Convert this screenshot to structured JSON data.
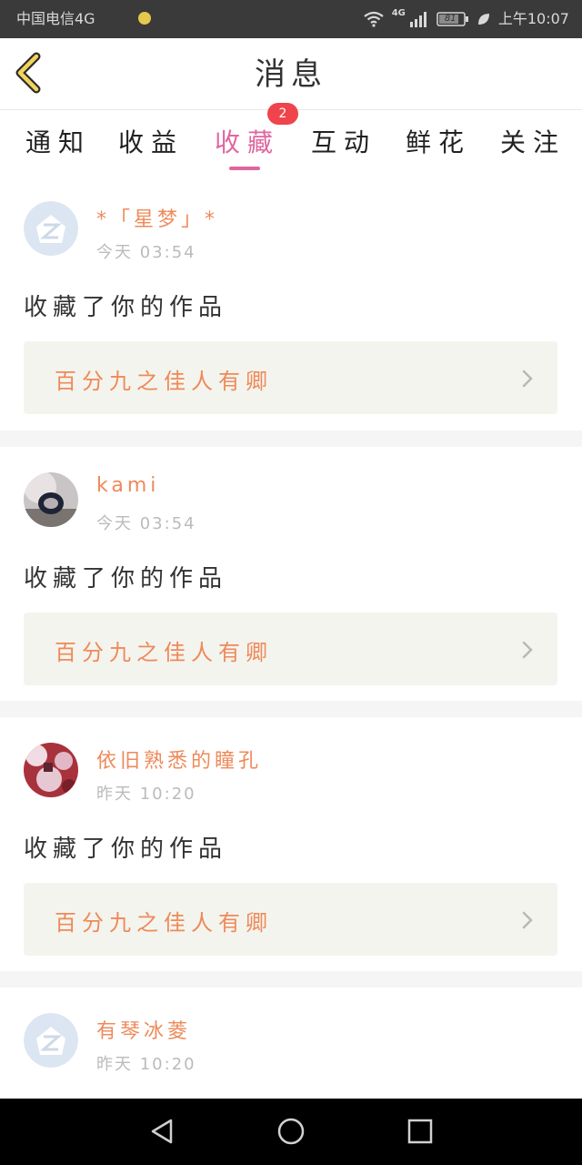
{
  "status_bar": {
    "carrier": "中国电信4G",
    "network": "4G",
    "battery": "81",
    "time": "上午10:07"
  },
  "header": {
    "title": "消息"
  },
  "tabs": [
    {
      "label": "通知"
    },
    {
      "label": "收益"
    },
    {
      "label": "收藏",
      "active": true,
      "badge": "2"
    },
    {
      "label": "互动"
    },
    {
      "label": "鲜花"
    },
    {
      "label": "关注"
    }
  ],
  "messages": [
    {
      "name": "*「星梦」*",
      "time": "今天 03:54",
      "text": "收藏了你的作品",
      "work": "百分九之佳人有卿",
      "avatar": "default-q-icon"
    },
    {
      "name": "kami",
      "time": "今天 03:54",
      "text": "收藏了你的作品",
      "work": "百分九之佳人有卿",
      "avatar": "photo"
    },
    {
      "name": "依旧熟悉的瞳孔",
      "time": "昨天 10:20",
      "text": "收藏了你的作品",
      "work": "百分九之佳人有卿",
      "avatar": "photo"
    },
    {
      "name": "有琴冰菱",
      "time": "昨天 10:20",
      "avatar": "default-q-icon"
    }
  ],
  "colors": {
    "accent": "#e066a0",
    "name_color": "#ee8a5a",
    "badge": "#f0444c",
    "card_bg": "#f4f4ee"
  }
}
